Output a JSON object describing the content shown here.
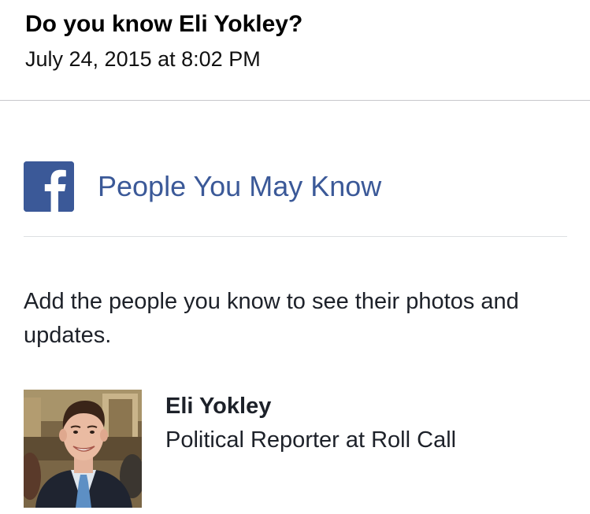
{
  "email": {
    "subject": "Do you know Eli Yokley?",
    "date": "July 24, 2015 at 8:02 PM"
  },
  "brand": {
    "title": "People You May Know",
    "logo_icon": "facebook-logo-icon",
    "color": "#3b5998"
  },
  "intro_text": "Add the people you know to see their photos and updates.",
  "person": {
    "name": "Eli Yokley",
    "title": "Political Reporter at Roll Call",
    "avatar_icon": "profile-photo"
  }
}
